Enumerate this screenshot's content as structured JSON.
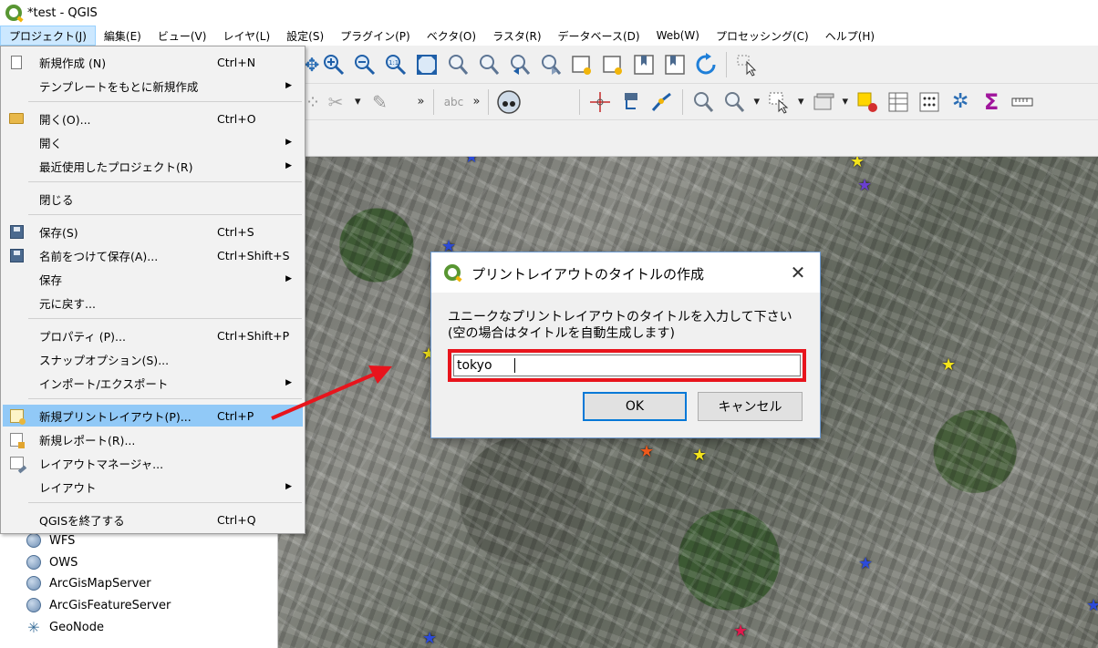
{
  "window": {
    "title": "*test - QGIS"
  },
  "menubar": {
    "items": [
      "プロジェクト(J)",
      "編集(E)",
      "ビュー(V)",
      "レイヤ(L)",
      "設定(S)",
      "プラグイン(P)",
      "ベクタ(O)",
      "ラスタ(R)",
      "データベース(D)",
      "Web(W)",
      "プロセッシング(C)",
      "ヘルプ(H)"
    ]
  },
  "project_menu": {
    "new": {
      "label": "新規作成 (N)",
      "shortcut": "Ctrl+N"
    },
    "new_from_template": {
      "label": "テンプレートをもとに新規作成"
    },
    "open": {
      "label": "開く(O)...",
      "shortcut": "Ctrl+O"
    },
    "open_from": {
      "label": "開く"
    },
    "recent": {
      "label": "最近使用したプロジェクト(R)"
    },
    "close": {
      "label": "閉じる"
    },
    "save": {
      "label": "保存(S)",
      "shortcut": "Ctrl+S"
    },
    "save_as": {
      "label": "名前をつけて保存(A)...",
      "shortcut": "Ctrl+Shift+S"
    },
    "save_to": {
      "label": "保存"
    },
    "revert": {
      "label": "元に戻す..."
    },
    "properties": {
      "label": "プロパティ (P)...",
      "shortcut": "Ctrl+Shift+P"
    },
    "snapping": {
      "label": "スナップオプション(S)..."
    },
    "import_export": {
      "label": "インポート/エクスポート"
    },
    "new_print_layout": {
      "label": "新規プリントレイアウト(P)...",
      "shortcut": "Ctrl+P"
    },
    "new_report": {
      "label": "新規レポート(R)..."
    },
    "layout_manager": {
      "label": "レイアウトマネージャ..."
    },
    "layouts": {
      "label": "レイアウト"
    },
    "exit": {
      "label": "QGISを終了する",
      "shortcut": "Ctrl+Q"
    }
  },
  "browser": {
    "items": [
      "WFS",
      "OWS",
      "ArcGisMapServer",
      "ArcGisFeatureServer",
      "GeoNode"
    ]
  },
  "dialog": {
    "title": "プリントレイアウトのタイトルの作成",
    "message_line1": "ユニークなプリントレイアウトのタイトルを入力して下さい",
    "message_line2": "(空の場合はタイトルを自動生成します)",
    "input_value": "tokyo",
    "ok_label": "OK",
    "cancel_label": "キャンセル"
  },
  "colors": {
    "highlight": "#91c9f7",
    "annotation_red": "#e8141c",
    "qgis_green": "#589632",
    "qgis_yellow": "#f1b50a"
  }
}
